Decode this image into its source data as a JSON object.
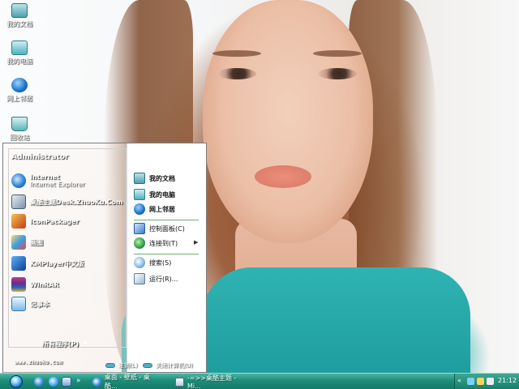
{
  "desktop": {
    "icons": [
      {
        "label": "我的文档",
        "icon": "documents-icon"
      },
      {
        "label": "我的电脑",
        "icon": "computer-icon"
      },
      {
        "label": "网上邻居",
        "icon": "network-icon"
      },
      {
        "label": "回收站",
        "icon": "recycle-bin-icon"
      }
    ]
  },
  "start_menu": {
    "user_name": "Administrator",
    "programs": [
      {
        "title": "Internet",
        "subtitle": "Internet Explorer",
        "icon": "internet-explorer-icon"
      },
      {
        "title": "桌酷主题Desk.ZhuoKu.Com",
        "icon": "desk-theme-icon"
      },
      {
        "title": "IconPackager",
        "icon": "iconpackager-icon"
      },
      {
        "title": "画图",
        "icon": "paint-icon"
      },
      {
        "title": "KMPlayer中文版",
        "icon": "kmplayer-icon"
      },
      {
        "title": "WinRAR",
        "icon": "winrar-icon"
      },
      {
        "title": "记事本",
        "icon": "notepad-icon"
      }
    ],
    "all_programs": "所有程序(P)",
    "website": "www.zhuoku.com",
    "right_items": [
      {
        "label": "我的文档",
        "icon": "my-documents-icon",
        "bold": true
      },
      {
        "label": "我的电脑",
        "icon": "my-computer-icon",
        "bold": true
      },
      {
        "label": "网上邻居",
        "icon": "network-places-icon",
        "bold": true
      },
      {
        "label": "控制面板(C)",
        "icon": "control-panel-icon"
      },
      {
        "label": "连接到(T)",
        "icon": "connect-to-icon",
        "submenu": true
      },
      {
        "label": "搜索(S)",
        "icon": "search-icon"
      },
      {
        "label": "运行(R)...",
        "icon": "run-icon"
      }
    ],
    "logoff": "注销(L)",
    "shutdown": "关闭计算机(U)"
  },
  "taskbar": {
    "tasks": [
      {
        "label": "桌面 - 壁纸 - 桌酷...",
        "icon": "ie-task-icon"
      },
      {
        "label": "-=>>桌酷主题 - Mi...",
        "icon": "document-task-icon"
      }
    ],
    "clock": "21:12"
  },
  "colors": {
    "taskbar": "#1e8d79",
    "shirt": "#2fb3b2",
    "accent_separator": "#2e8f3a"
  }
}
